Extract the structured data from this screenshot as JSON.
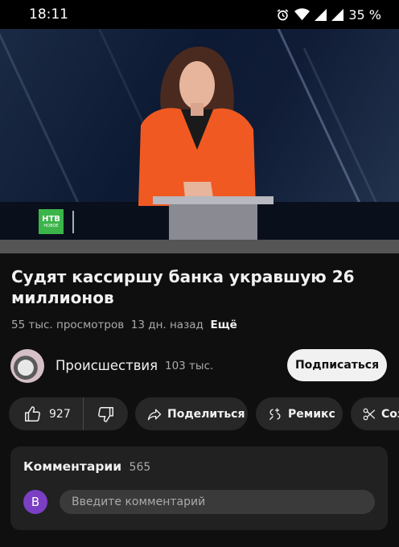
{
  "status_bar": {
    "time": "18:11",
    "battery": "35 %"
  },
  "video": {
    "channel_logo_text": "НТВ",
    "channel_logo_subtext": "НОВОЕ",
    "progress": 0
  },
  "title": "Судят кассиршу банка укравшую 26 миллионов",
  "meta": {
    "views": "55 тыс. просмотров",
    "age": "13 дн. назад",
    "more": "Ещё"
  },
  "channel": {
    "name": "Происшествия",
    "subscribers": "103 тыс.",
    "subscribe_label": "Подписаться"
  },
  "actions": {
    "likes": "927",
    "share": "Поделиться",
    "remix": "Ремикс",
    "clip": "Создать клип"
  },
  "comments": {
    "title": "Комментарии",
    "count": "565",
    "avatar_letter": "В",
    "placeholder": "Введите комментарий"
  },
  "colors": {
    "background": "#0f0f0f",
    "pill": "#272727",
    "card": "#212121",
    "avatar": "#7b3fc4",
    "logo_green": "#3bb54a"
  }
}
